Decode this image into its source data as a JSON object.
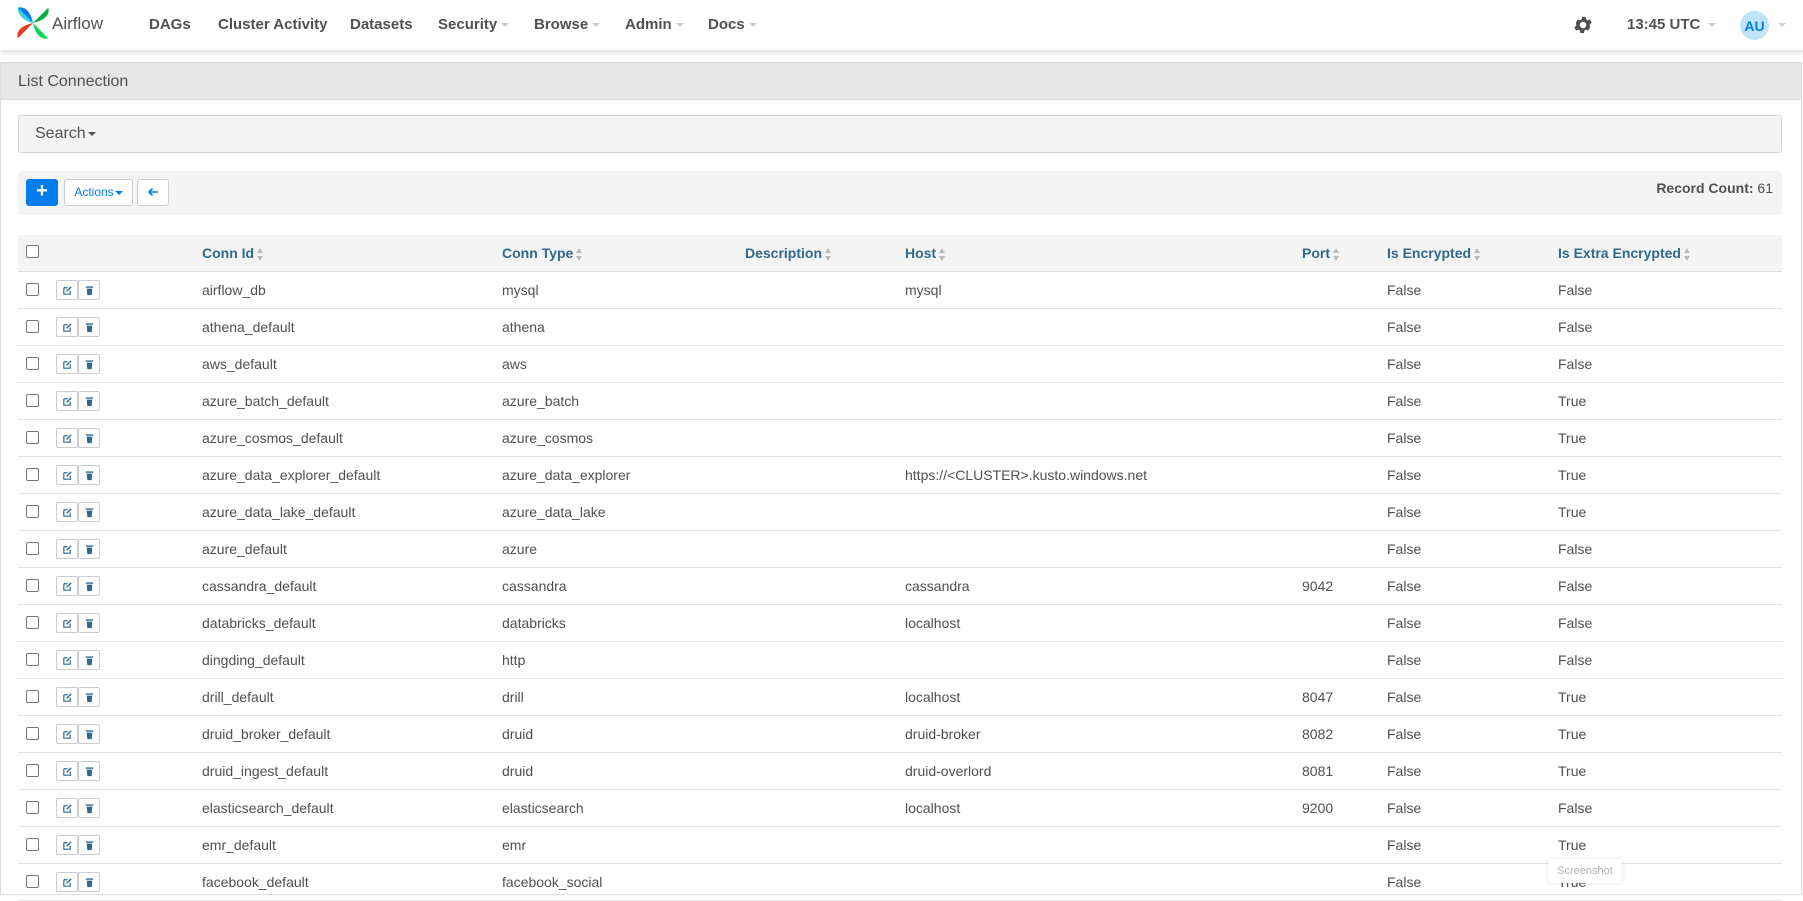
{
  "nav": {
    "brand": "Airflow",
    "items": [
      {
        "label": "DAGs",
        "dropdown": false
      },
      {
        "label": "Cluster Activity",
        "dropdown": false
      },
      {
        "label": "Datasets",
        "dropdown": false
      },
      {
        "label": "Security",
        "dropdown": true
      },
      {
        "label": "Browse",
        "dropdown": true
      },
      {
        "label": "Admin",
        "dropdown": true
      },
      {
        "label": "Docs",
        "dropdown": true
      }
    ],
    "time": "13:45 UTC",
    "user_initials": "AU"
  },
  "page": {
    "title": "List Connection",
    "search_label": "Search",
    "actions_label": "Actions",
    "add_label": "+",
    "record_count_label": "Record Count:",
    "record_count": "61"
  },
  "table": {
    "columns": [
      "Conn Id",
      "Conn Type",
      "Description",
      "Host",
      "Port",
      "Is Encrypted",
      "Is Extra Encrypted"
    ],
    "rows": [
      [
        "airflow_db",
        "mysql",
        "",
        "mysql",
        "",
        "False",
        "False"
      ],
      [
        "athena_default",
        "athena",
        "",
        "",
        "",
        "False",
        "False"
      ],
      [
        "aws_default",
        "aws",
        "",
        "",
        "",
        "False",
        "False"
      ],
      [
        "azure_batch_default",
        "azure_batch",
        "",
        "",
        "",
        "False",
        "True"
      ],
      [
        "azure_cosmos_default",
        "azure_cosmos",
        "",
        "",
        "",
        "False",
        "True"
      ],
      [
        "azure_data_explorer_default",
        "azure_data_explorer",
        "",
        "https://<CLUSTER>.kusto.windows.net",
        "",
        "False",
        "True"
      ],
      [
        "azure_data_lake_default",
        "azure_data_lake",
        "",
        "",
        "",
        "False",
        "True"
      ],
      [
        "azure_default",
        "azure",
        "",
        "",
        "",
        "False",
        "False"
      ],
      [
        "cassandra_default",
        "cassandra",
        "",
        "cassandra",
        "9042",
        "False",
        "False"
      ],
      [
        "databricks_default",
        "databricks",
        "",
        "localhost",
        "",
        "False",
        "False"
      ],
      [
        "dingding_default",
        "http",
        "",
        "",
        "",
        "False",
        "False"
      ],
      [
        "drill_default",
        "drill",
        "",
        "localhost",
        "8047",
        "False",
        "True"
      ],
      [
        "druid_broker_default",
        "druid",
        "",
        "druid-broker",
        "8082",
        "False",
        "True"
      ],
      [
        "druid_ingest_default",
        "druid",
        "",
        "druid-overlord",
        "8081",
        "False",
        "True"
      ],
      [
        "elasticsearch_default",
        "elasticsearch",
        "",
        "localhost",
        "9200",
        "False",
        "False"
      ],
      [
        "emr_default",
        "emr",
        "",
        "",
        "",
        "False",
        "True"
      ],
      [
        "facebook_default",
        "facebook_social",
        "",
        "",
        "",
        "False",
        "True"
      ]
    ]
  },
  "watermark": "Screenshot"
}
